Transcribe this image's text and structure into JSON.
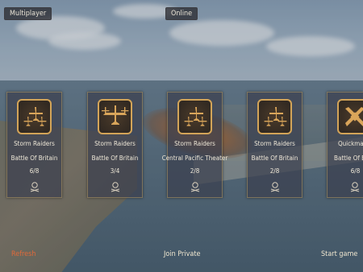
{
  "header": {
    "mode_tab": "Multiplayer",
    "status_tab": "Online"
  },
  "colors": {
    "accent_gold": "#d3a458",
    "refresh_color": "#e06a3a"
  },
  "lobbies": [
    {
      "title": "Storm Raiders",
      "map": "Battle Of Britain",
      "players": "6/8",
      "icon": "three-planes-icon"
    },
    {
      "title": "Storm Raiders",
      "map": "Battle Of Britain",
      "players": "3/4",
      "icon": "three-planes-large-icon"
    },
    {
      "title": "Storm Raiders",
      "map": "Central Pacific Theater",
      "players": "2/8",
      "icon": "three-planes-icon"
    },
    {
      "title": "Storm Raiders",
      "map": "Battle Of Britain",
      "players": "2/8",
      "icon": "three-planes-icon"
    },
    {
      "title": "Quickmatch",
      "map": "Battle Of Britain",
      "players": "6/8",
      "icon": "crossed-planes-icon"
    }
  ],
  "footer": {
    "refresh": "Refresh",
    "join_private": "Join Private",
    "start_game": "Start game"
  }
}
